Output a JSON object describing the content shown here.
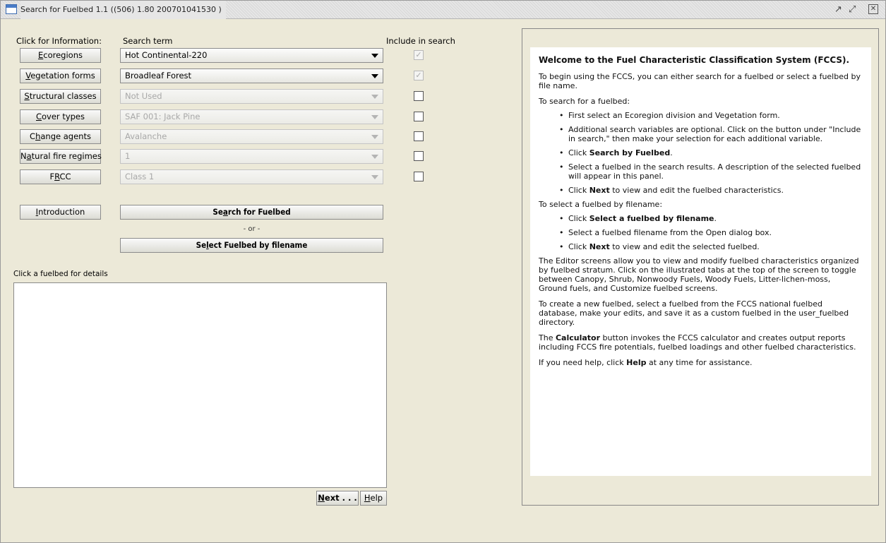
{
  "window": {
    "title": "Search for Fuelbed 1.1 ((506) 1.80 200701041530 )",
    "controls": [
      "restore",
      "maximize",
      "close"
    ]
  },
  "left": {
    "click_info_label": "Click for Information:",
    "search_term_label": "Search term",
    "include_label": "Include in search",
    "rows": [
      {
        "button_pre": "",
        "button_key": "E",
        "button_post": "coregions",
        "value": "Hot Continental-220",
        "enabled": true,
        "include_checked": true
      },
      {
        "button_pre": "",
        "button_key": "V",
        "button_post": "egetation forms",
        "value": "Broadleaf Forest",
        "enabled": true,
        "include_checked": true
      },
      {
        "button_pre": "",
        "button_key": "S",
        "button_post": "tructural classes",
        "value": "Not Used",
        "enabled": false,
        "include_checked": false
      },
      {
        "button_pre": "",
        "button_key": "C",
        "button_post": "over types",
        "value": "SAF 001: Jack Pine",
        "enabled": false,
        "include_checked": false
      },
      {
        "button_pre": "C",
        "button_key": "h",
        "button_post": "ange agents",
        "value": "Avalanche",
        "enabled": false,
        "include_checked": false
      },
      {
        "button_pre": "N",
        "button_key": "a",
        "button_post": "tural fire regimes",
        "value": "1",
        "enabled": false,
        "include_checked": false
      },
      {
        "button_pre": "F",
        "button_key": "R",
        "button_post": "CC",
        "value": "Class 1",
        "enabled": false,
        "include_checked": false
      }
    ],
    "introduction": {
      "pre": "",
      "key": "I",
      "post": "ntroduction"
    },
    "search_button": {
      "pre": "Se",
      "key": "a",
      "post": "rch for Fuelbed"
    },
    "or_text": "- or -",
    "select_button": {
      "pre": "Se",
      "key": "l",
      "post": "ect Fuelbed by filename"
    },
    "results_label": "Click a fuelbed for details",
    "next_button": {
      "pre": "",
      "key": "N",
      "post": "ext . . ."
    },
    "help_button": {
      "pre": "",
      "key": "H",
      "post": "elp"
    }
  },
  "info": {
    "welcome": "Welcome to the Fuel Characteristic Classification System (FCCS).",
    "intro": "To begin using the FCCS, you can either search for a fuelbed or select a fuelbed by file name.",
    "search_heading": "To search for a fuelbed:",
    "search_steps": {
      "s1": "First select an Ecoregion division and Vegetation form.",
      "s2": "Additional search variables are optional.  Click on the button under \"Include in search,\" then make your selection for each additional variable.",
      "s3_pre": "Click ",
      "s3_bold": "Search by Fuelbed",
      "s3_post": ".",
      "s4": "Select a fuelbed in the search results.  A description of the selected fuelbed will appear in this panel.",
      "s5_pre": "Click ",
      "s5_bold": "Next",
      "s5_post": " to view and edit the fuelbed characteristics."
    },
    "select_heading": "To select a fuelbed by filename:",
    "select_steps": {
      "s1_pre": "Click ",
      "s1_bold": "Select a fuelbed by filename",
      "s1_post": ".",
      "s2": "Select a fuelbed filename from the Open dialog box.",
      "s3_pre": "Click ",
      "s3_bold": "Next",
      "s3_post": " to view and edit the selected fuelbed."
    },
    "editor": "The Editor screens allow you to view and modify fuelbed characteristics organized by fuelbed stratum. Click on the illustrated tabs at the top of the screen to toggle between Canopy, Shrub, Nonwoody Fuels, Woody Fuels, Litter-lichen-moss, Ground fuels, and Customize fuelbed screens.",
    "create": "To create a new fuelbed, select a fuelbed from the FCCS national fuelbed database, make your edits, and save it as a custom fuelbed in the user_fuelbed directory.",
    "calc_pre": "The ",
    "calc_bold": "Calculator",
    "calc_post": " button invokes the FCCS calculator and creates output reports including FCCS fire potentials, fuelbed loadings and other fuelbed characteristics.",
    "help_pre": "If you need help, click ",
    "help_bold": "Help",
    "help_post": " at any time for assistance."
  }
}
